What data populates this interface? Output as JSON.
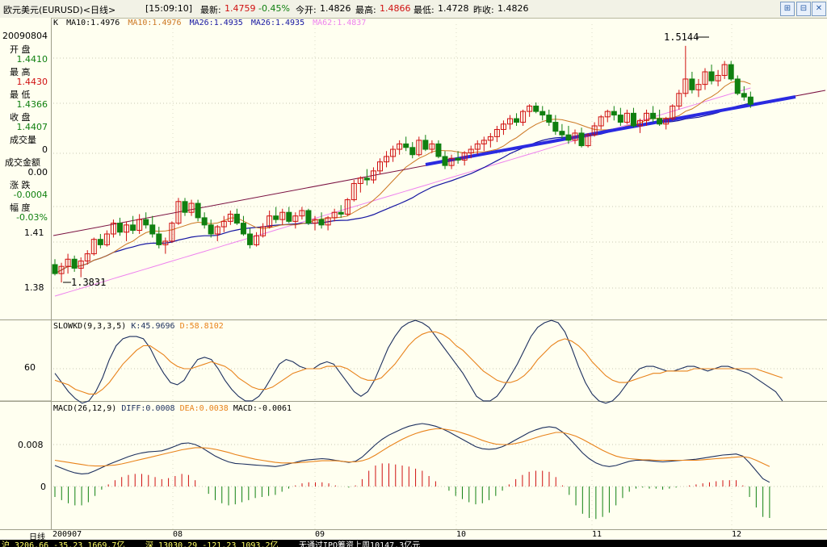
{
  "titlebar": {
    "instrument": "欧元美元(EURUSD)<日线>",
    "time": "[15:09:10]",
    "latest_label": "最新:",
    "latest": "1.4759",
    "change": "-0.45%",
    "open_label": "今开:",
    "open": "1.4826",
    "high_label": "最高:",
    "high": "1.4866",
    "low_label": "最低:",
    "low": "1.4728",
    "prev_label": "昨收:",
    "prev": "1.4826"
  },
  "left_panel": {
    "date": "20090804",
    "open_label": "开  盘",
    "open": "1.4410",
    "high_label": "最  高",
    "high": "1.4430",
    "low_label": "最  低",
    "low": "1.4366",
    "close_label": "收  盘",
    "close": "1.4407",
    "volume_label": "成交量",
    "volume": "0",
    "amount_label": "成交金额",
    "amount": "0.00",
    "change_label": "涨  跌",
    "change": "-0.0004",
    "pct_label": "幅  度",
    "pct": "-0.03%",
    "period_label": "日线"
  },
  "colors": {
    "up": "#d01010",
    "down": "#108010",
    "ma10": "#cc7722",
    "ma26": "#1414a0",
    "ma62": "#ee82ee",
    "trend": "#2a2ae0",
    "k": "#1c2f5e",
    "d": "#e8821a",
    "dif": "#1c2f5e",
    "dea": "#e8821a"
  },
  "chart_data": [
    {
      "type": "candlestick",
      "title": "K",
      "legend": [
        "MA10:1.4976",
        "MA10:1.4976",
        "MA26:1.4935",
        "MA26:1.4935",
        "MA62:1.4837"
      ],
      "ylabels": [
        "1.41",
        "1.38"
      ],
      "annotations": [
        "1.5144",
        "1.3831"
      ],
      "series_ohlc": [
        [
          1.393,
          1.396,
          1.387,
          1.388
        ],
        [
          1.388,
          1.394,
          1.3831,
          1.392
        ],
        [
          1.392,
          1.399,
          1.388,
          1.396
        ],
        [
          1.396,
          1.398,
          1.389,
          1.391
        ],
        [
          1.391,
          1.397,
          1.386,
          1.395
        ],
        [
          1.395,
          1.401,
          1.393,
          1.399
        ],
        [
          1.399,
          1.408,
          1.398,
          1.407
        ],
        [
          1.407,
          1.41,
          1.402,
          1.404
        ],
        [
          1.404,
          1.412,
          1.403,
          1.41
        ],
        [
          1.41,
          1.418,
          1.408,
          1.416
        ],
        [
          1.416,
          1.419,
          1.409,
          1.411
        ],
        [
          1.411,
          1.417,
          1.406,
          1.415
        ],
        [
          1.415,
          1.42,
          1.41,
          1.412
        ],
        [
          1.412,
          1.421,
          1.41,
          1.418
        ],
        [
          1.418,
          1.422,
          1.413,
          1.415
        ],
        [
          1.415,
          1.42,
          1.408,
          1.41
        ],
        [
          1.41,
          1.414,
          1.402,
          1.404
        ],
        [
          1.404,
          1.408,
          1.399,
          1.406
        ],
        [
          1.406,
          1.417,
          1.405,
          1.416
        ],
        [
          1.416,
          1.43,
          1.415,
          1.428
        ],
        [
          1.428,
          1.43,
          1.42,
          1.422
        ],
        [
          1.422,
          1.429,
          1.42,
          1.427
        ],
        [
          1.427,
          1.429,
          1.417,
          1.419
        ],
        [
          1.419,
          1.422,
          1.413,
          1.415
        ],
        [
          1.415,
          1.418,
          1.408,
          1.41
        ],
        [
          1.41,
          1.415,
          1.406,
          1.414
        ],
        [
          1.414,
          1.42,
          1.411,
          1.417
        ],
        [
          1.417,
          1.423,
          1.415,
          1.421
        ],
        [
          1.421,
          1.424,
          1.415,
          1.416
        ],
        [
          1.416,
          1.42,
          1.409,
          1.41
        ],
        [
          1.41,
          1.413,
          1.402,
          1.404
        ],
        [
          1.404,
          1.411,
          1.403,
          1.409
        ],
        [
          1.409,
          1.416,
          1.408,
          1.414
        ],
        [
          1.414,
          1.423,
          1.413,
          1.42
        ],
        [
          1.42,
          1.425,
          1.416,
          1.418
        ],
        [
          1.418,
          1.424,
          1.415,
          1.422
        ],
        [
          1.422,
          1.425,
          1.416,
          1.417
        ],
        [
          1.417,
          1.422,
          1.413,
          1.42
        ],
        [
          1.42,
          1.425,
          1.418,
          1.423
        ],
        [
          1.423,
          1.424,
          1.415,
          1.416
        ],
        [
          1.416,
          1.42,
          1.412,
          1.418
        ],
        [
          1.418,
          1.422,
          1.413,
          1.415
        ],
        [
          1.415,
          1.42,
          1.412,
          1.419
        ],
        [
          1.419,
          1.424,
          1.417,
          1.422
        ],
        [
          1.422,
          1.426,
          1.419,
          1.421
        ],
        [
          1.421,
          1.43,
          1.42,
          1.429
        ],
        [
          1.429,
          1.44,
          1.428,
          1.438
        ],
        [
          1.438,
          1.442,
          1.433,
          1.441
        ],
        [
          1.441,
          1.446,
          1.437,
          1.44
        ],
        [
          1.44,
          1.447,
          1.438,
          1.445
        ],
        [
          1.445,
          1.452,
          1.443,
          1.45
        ],
        [
          1.45,
          1.456,
          1.447,
          1.453
        ],
        [
          1.453,
          1.459,
          1.45,
          1.457
        ],
        [
          1.457,
          1.462,
          1.454,
          1.46
        ],
        [
          1.46,
          1.464,
          1.456,
          1.458
        ],
        [
          1.458,
          1.461,
          1.452,
          1.454
        ],
        [
          1.454,
          1.464,
          1.453,
          1.462
        ],
        [
          1.462,
          1.465,
          1.456,
          1.457
        ],
        [
          1.457,
          1.462,
          1.455,
          1.46
        ],
        [
          1.46,
          1.462,
          1.452,
          1.453
        ],
        [
          1.453,
          1.456,
          1.446,
          1.448
        ],
        [
          1.448,
          1.454,
          1.446,
          1.452
        ],
        [
          1.452,
          1.456,
          1.449,
          1.451
        ],
        [
          1.451,
          1.456,
          1.448,
          1.455
        ],
        [
          1.455,
          1.459,
          1.452,
          1.457
        ],
        [
          1.457,
          1.462,
          1.454,
          1.46
        ],
        [
          1.46,
          1.464,
          1.456,
          1.462
        ],
        [
          1.462,
          1.466,
          1.458,
          1.464
        ],
        [
          1.464,
          1.47,
          1.461,
          1.468
        ],
        [
          1.468,
          1.473,
          1.465,
          1.471
        ],
        [
          1.471,
          1.476,
          1.468,
          1.474
        ],
        [
          1.474,
          1.477,
          1.47,
          1.472
        ],
        [
          1.472,
          1.479,
          1.47,
          1.478
        ],
        [
          1.478,
          1.482,
          1.475,
          1.481
        ],
        [
          1.481,
          1.483,
          1.477,
          1.478
        ],
        [
          1.478,
          1.481,
          1.473,
          1.476
        ],
        [
          1.476,
          1.479,
          1.47,
          1.472
        ],
        [
          1.472,
          1.476,
          1.465,
          1.467
        ],
        [
          1.467,
          1.471,
          1.463,
          1.465
        ],
        [
          1.465,
          1.47,
          1.46,
          1.462
        ],
        [
          1.462,
          1.468,
          1.46,
          1.466
        ],
        [
          1.466,
          1.469,
          1.458,
          1.459
        ],
        [
          1.459,
          1.466,
          1.458,
          1.465
        ],
        [
          1.465,
          1.472,
          1.464,
          1.47
        ],
        [
          1.47,
          1.476,
          1.468,
          1.475
        ],
        [
          1.475,
          1.479,
          1.472,
          1.478
        ],
        [
          1.478,
          1.481,
          1.473,
          1.476
        ],
        [
          1.476,
          1.48,
          1.47,
          1.472
        ],
        [
          1.472,
          1.479,
          1.471,
          1.477
        ],
        [
          1.477,
          1.48,
          1.469,
          1.47
        ],
        [
          1.47,
          1.474,
          1.466,
          1.473
        ],
        [
          1.473,
          1.479,
          1.47,
          1.477
        ],
        [
          1.477,
          1.481,
          1.472,
          1.474
        ],
        [
          1.474,
          1.479,
          1.47,
          1.471
        ],
        [
          1.471,
          1.475,
          1.468,
          1.474
        ],
        [
          1.474,
          1.482,
          1.473,
          1.481
        ],
        [
          1.481,
          1.49,
          1.479,
          1.488
        ],
        [
          1.488,
          1.5144,
          1.486,
          1.496
        ],
        [
          1.496,
          1.5,
          1.488,
          1.49
        ],
        [
          1.49,
          1.496,
          1.486,
          1.493
        ],
        [
          1.493,
          1.502,
          1.49,
          1.5
        ],
        [
          1.5,
          1.504,
          1.493,
          1.495
        ],
        [
          1.495,
          1.501,
          1.492,
          1.498
        ],
        [
          1.498,
          1.506,
          1.496,
          1.504
        ],
        [
          1.504,
          1.506,
          1.495,
          1.496
        ],
        [
          1.496,
          1.498,
          1.487,
          1.488
        ],
        [
          1.488,
          1.492,
          1.484,
          1.486
        ],
        [
          1.486,
          1.489,
          1.48,
          1.482
        ]
      ]
    },
    {
      "type": "line",
      "title": "SLOWKD(9,3,3,5)",
      "legend": [
        "K:45.9696",
        "D:58.8102"
      ],
      "ylabels": [
        "60"
      ],
      "series": [
        {
          "name": "K",
          "values": [
            58,
            54,
            50,
            47,
            45,
            46,
            50,
            56,
            64,
            70,
            73,
            74,
            74,
            73,
            69,
            63,
            58,
            54,
            53,
            55,
            60,
            64,
            65,
            64,
            60,
            55,
            51,
            48,
            46,
            46,
            48,
            52,
            57,
            62,
            64,
            63,
            61,
            60,
            60,
            62,
            63,
            62,
            58,
            54,
            50,
            48,
            50,
            55,
            62,
            69,
            74,
            78,
            80,
            81,
            80,
            78,
            74,
            70,
            66,
            62,
            58,
            53,
            48,
            46,
            46,
            48,
            52,
            57,
            62,
            68,
            74,
            78,
            80,
            81,
            80,
            76,
            69,
            61,
            54,
            49,
            46,
            45,
            46,
            49,
            53,
            57,
            60,
            61,
            61,
            60,
            59,
            59,
            60,
            61,
            61,
            60,
            59,
            60,
            61,
            61,
            60,
            59,
            58,
            56,
            54,
            52,
            50,
            46
          ]
        },
        {
          "name": "D",
          "values": [
            55,
            54,
            53,
            51,
            50,
            49,
            49,
            51,
            54,
            58,
            62,
            65,
            68,
            70,
            70,
            68,
            66,
            63,
            61,
            60,
            60,
            61,
            62,
            63,
            62,
            61,
            59,
            56,
            54,
            52,
            51,
            51,
            52,
            54,
            56,
            58,
            59,
            60,
            60,
            60,
            61,
            61,
            61,
            60,
            58,
            56,
            55,
            55,
            56,
            59,
            62,
            66,
            70,
            73,
            75,
            76,
            76,
            75,
            73,
            70,
            68,
            65,
            62,
            59,
            57,
            55,
            54,
            54,
            55,
            57,
            60,
            64,
            67,
            70,
            72,
            73,
            72,
            70,
            67,
            63,
            60,
            57,
            55,
            54,
            54,
            55,
            56,
            57,
            58,
            58,
            59,
            59,
            59,
            59,
            60,
            60,
            60,
            60,
            60,
            60,
            60,
            60,
            60,
            60,
            59,
            58,
            57,
            56
          ]
        }
      ]
    },
    {
      "type": "line+bar",
      "title": "MACD(26,12,9)",
      "legend": [
        "DIFF:0.0008",
        "DEA:0.0038",
        "MACD:-0.0061"
      ],
      "ylabels": [
        "0.008",
        "0"
      ],
      "series": [
        {
          "name": "DIFF",
          "values": [
            0.004,
            0.0035,
            0.003,
            0.0026,
            0.0024,
            0.0025,
            0.003,
            0.0036,
            0.0042,
            0.0047,
            0.0052,
            0.0057,
            0.0061,
            0.0064,
            0.0066,
            0.0067,
            0.0068,
            0.0072,
            0.0077,
            0.0082,
            0.0083,
            0.008,
            0.0074,
            0.0066,
            0.0058,
            0.0052,
            0.0047,
            0.0044,
            0.0043,
            0.0042,
            0.0041,
            0.004,
            0.0039,
            0.0038,
            0.004,
            0.0043,
            0.0046,
            0.0049,
            0.0051,
            0.0052,
            0.0053,
            0.0052,
            0.005,
            0.0048,
            0.0046,
            0.0048,
            0.0056,
            0.0068,
            0.008,
            0.009,
            0.0098,
            0.0104,
            0.011,
            0.0115,
            0.0118,
            0.012,
            0.0118,
            0.0115,
            0.011,
            0.0104,
            0.0097,
            0.009,
            0.0083,
            0.0076,
            0.0072,
            0.0071,
            0.0072,
            0.0076,
            0.0082,
            0.0089,
            0.0096,
            0.0103,
            0.0108,
            0.0112,
            0.0114,
            0.0112,
            0.0104,
            0.0092,
            0.0078,
            0.0064,
            0.0053,
            0.0045,
            0.004,
            0.0038,
            0.004,
            0.0044,
            0.0048,
            0.005,
            0.005,
            0.0049,
            0.0048,
            0.0047,
            0.0048,
            0.0049,
            0.005,
            0.0051,
            0.0052,
            0.0054,
            0.0056,
            0.0058,
            0.006,
            0.0061,
            0.0062,
            0.0058,
            0.0045,
            0.003,
            0.0015,
            0.0008
          ]
        },
        {
          "name": "DEA",
          "values": [
            0.005,
            0.0048,
            0.0046,
            0.0044,
            0.0042,
            0.004,
            0.0039,
            0.0039,
            0.004,
            0.0041,
            0.0043,
            0.0046,
            0.0049,
            0.0052,
            0.0055,
            0.0058,
            0.0061,
            0.0064,
            0.0067,
            0.007,
            0.0072,
            0.0074,
            0.0074,
            0.0073,
            0.0071,
            0.0068,
            0.0065,
            0.0061,
            0.0058,
            0.0055,
            0.0052,
            0.005,
            0.0048,
            0.0046,
            0.0045,
            0.0045,
            0.0045,
            0.0046,
            0.0047,
            0.0048,
            0.0049,
            0.0049,
            0.0049,
            0.0048,
            0.0047,
            0.0047,
            0.0049,
            0.0053,
            0.006,
            0.0068,
            0.0076,
            0.0083,
            0.009,
            0.0096,
            0.0101,
            0.0105,
            0.0108,
            0.011,
            0.011,
            0.0108,
            0.0106,
            0.0102,
            0.0098,
            0.0093,
            0.0088,
            0.0084,
            0.0081,
            0.008,
            0.008,
            0.0082,
            0.0085,
            0.0089,
            0.0093,
            0.0097,
            0.01,
            0.0103,
            0.0103,
            0.01,
            0.0096,
            0.009,
            0.0083,
            0.0076,
            0.0069,
            0.0063,
            0.0058,
            0.0055,
            0.0053,
            0.0052,
            0.0051,
            0.0051,
            0.005,
            0.005,
            0.005,
            0.005,
            0.005,
            0.005,
            0.005,
            0.0051,
            0.0052,
            0.0053,
            0.0054,
            0.0055,
            0.0056,
            0.0057,
            0.0055,
            0.005,
            0.0044,
            0.0038
          ]
        }
      ]
    }
  ],
  "date_axis": [
    "200907",
    "08",
    "09",
    "10",
    "11",
    "12"
  ],
  "status": {
    "left": "沪  3206.66  -35.23 1669.7亿",
    "mid": "深  13030.29  -121.23 1093.2亿",
    "right": "无通过IPO筹资上周10147.3亿元"
  }
}
